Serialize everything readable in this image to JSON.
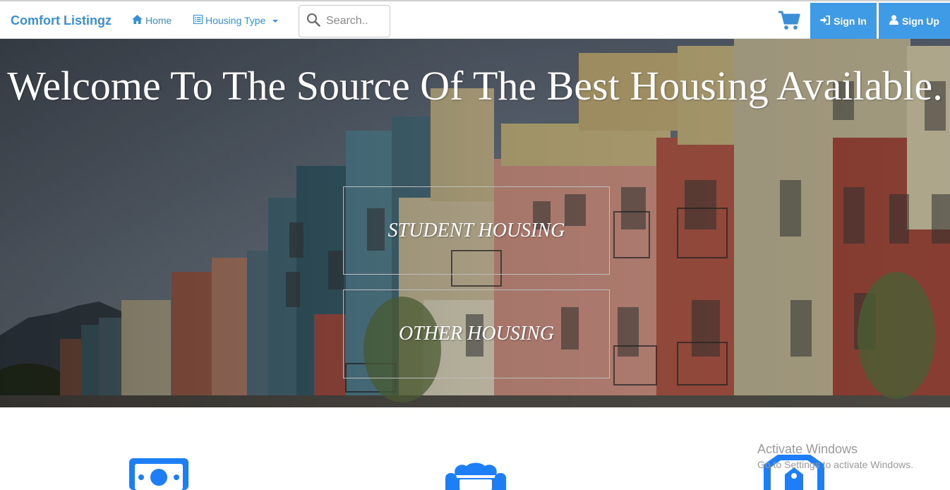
{
  "navbar": {
    "brand": "Comfort Listingz",
    "home_label": "Home",
    "housing_type_label": "Housing Type",
    "search_placeholder": "Search..",
    "signin_label": "Sign In",
    "signup_label": "Sign Up",
    "accent_color": "#3b8fd6"
  },
  "hero": {
    "title": "Welcome To The Source Of The Best Housing Available.",
    "student_housing_label": "STUDENT HOUSING",
    "other_housing_label": "OTHER HOUSING"
  },
  "features": {
    "icons": [
      "money-icon",
      "sofa-icon",
      "shield-icon"
    ],
    "icon_color": "#1e7ef5"
  },
  "watermark": {
    "title": "Activate Windows",
    "subtitle": "Go to Settings to activate Windows."
  }
}
